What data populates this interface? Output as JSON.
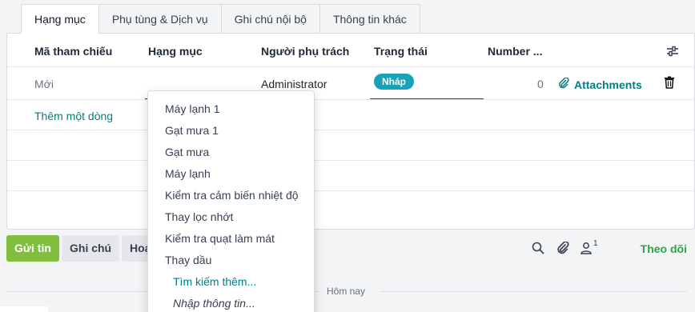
{
  "tabs": [
    "Hạng mục",
    "Phụ tùng & Dịch vụ",
    "Ghi chú nội bộ",
    "Thông tin khác"
  ],
  "table": {
    "headers": [
      "Mã tham chiếu",
      "Hạng mục",
      "Người phụ trách",
      "Trạng thái",
      "Number ..."
    ],
    "row": {
      "ref": "Mới",
      "assignee": "Administrator",
      "status": "Nháp",
      "number": "0",
      "attachments": "Attachments"
    },
    "add_line": "Thêm một dòng"
  },
  "dropdown": {
    "items": [
      "Máy lạnh 1",
      "Gạt mưa 1",
      "Gạt mưa",
      "Máy lạnh",
      "Kiểm tra cảm biến nhiệt độ",
      "Thay lọc nhớt",
      "Kiểm tra quạt làm mát",
      "Thay dầu"
    ],
    "search_more": "Tìm kiếm thêm...",
    "create": "Nhập thông tin..."
  },
  "chatter": {
    "send": "Gửi tin",
    "note": "Ghi chú",
    "activity": "Hoạt động",
    "follower_count": "1",
    "follow": "Theo dõi",
    "date_separator": "Hôm nay"
  },
  "colors": {
    "accent": "#017e84",
    "status_badge": "#17a2b8",
    "send_button": "#7fbf3d",
    "follow": "#28a745"
  },
  "icons": [
    "settings-sliders-icon",
    "paperclip-icon",
    "trash-icon",
    "search-icon",
    "user-icon"
  ]
}
